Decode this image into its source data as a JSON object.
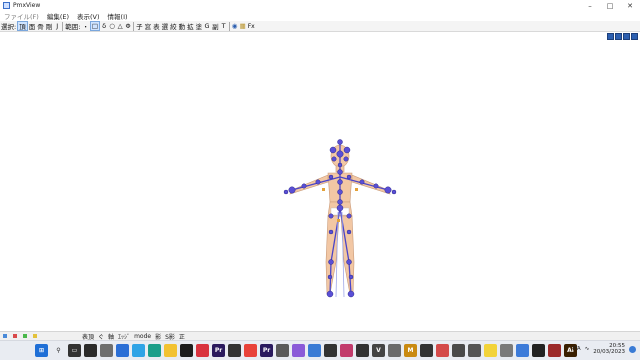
{
  "window": {
    "title": "PmxView"
  },
  "menu": [
    {
      "label": "ファイル(F)",
      "disabled": true
    },
    {
      "label": "編集(E)",
      "disabled": false
    },
    {
      "label": "表示(V)",
      "disabled": false
    },
    {
      "label": "情報(I)",
      "disabled": false
    }
  ],
  "toolbar": {
    "select_label": "選択:",
    "items_a": [
      "頂",
      "面",
      "骨",
      "剛",
      "J"
    ],
    "range_label": "範囲:",
    "items_b": [
      "・",
      "□",
      "δ",
      "○",
      "△",
      "Φ"
    ],
    "items_c": [
      "子",
      "窓",
      "表",
      "選",
      "絞",
      "動",
      "拡",
      "塗",
      "G",
      "副",
      "T"
    ],
    "fx_label": "Fx"
  },
  "statusbar": {
    "labels": [
      "表頂",
      "ぐ",
      "軸",
      "ｴｯｼﾞ",
      "mode",
      "影",
      "S影",
      "正"
    ]
  },
  "taskbar": {
    "apps": [
      {
        "name": "search",
        "glyph": "⚲",
        "color": "#e9ecf2"
      },
      {
        "name": "task-view",
        "glyph": "▭",
        "color": "#333333"
      },
      {
        "name": "app-1",
        "glyph": "",
        "color": "#2b2b2b"
      },
      {
        "name": "app-2",
        "glyph": "",
        "color": "#6e6e6e"
      },
      {
        "name": "app-3",
        "glyph": "",
        "color": "#2b6fd6"
      },
      {
        "name": "app-4",
        "glyph": "",
        "color": "#2fa3e6"
      },
      {
        "name": "edge",
        "glyph": "",
        "color": "#1b9e8a"
      },
      {
        "name": "explorer",
        "glyph": "",
        "color": "#f2c232"
      },
      {
        "name": "app-5",
        "glyph": "",
        "color": "#1d1d1d"
      },
      {
        "name": "app-6",
        "glyph": "",
        "color": "#d9333f"
      },
      {
        "name": "premiere-1",
        "glyph": "Pr",
        "color": "#2a1a5e"
      },
      {
        "name": "app-7",
        "glyph": "",
        "color": "#333333"
      },
      {
        "name": "app-8",
        "glyph": "",
        "color": "#e8423a"
      },
      {
        "name": "premiere-2",
        "glyph": "Pr",
        "color": "#2a1a5e"
      },
      {
        "name": "app-9",
        "glyph": "",
        "color": "#5a5a5a"
      },
      {
        "name": "app-10",
        "glyph": "",
        "color": "#8a5ad8"
      },
      {
        "name": "app-11",
        "glyph": "",
        "color": "#3a7bd5"
      },
      {
        "name": "app-12",
        "glyph": "",
        "color": "#333333"
      },
      {
        "name": "app-13",
        "glyph": "",
        "color": "#c23b6c"
      },
      {
        "name": "app-14",
        "glyph": "",
        "color": "#333333"
      },
      {
        "name": "app-15",
        "glyph": "V",
        "color": "#444444"
      },
      {
        "name": "app-16",
        "glyph": "",
        "color": "#6b6b6b"
      },
      {
        "name": "app-17",
        "glyph": "M",
        "color": "#c98a12"
      },
      {
        "name": "app-18",
        "glyph": "",
        "color": "#333333"
      },
      {
        "name": "app-19",
        "glyph": "",
        "color": "#d44a4a"
      },
      {
        "name": "app-20",
        "glyph": "",
        "color": "#4a4a4a"
      },
      {
        "name": "app-21",
        "glyph": "",
        "color": "#555555"
      },
      {
        "name": "app-22",
        "glyph": "",
        "color": "#f2d33a"
      },
      {
        "name": "app-23",
        "glyph": "",
        "color": "#7a7a7a"
      },
      {
        "name": "app-24",
        "glyph": "",
        "color": "#3d7bd9"
      },
      {
        "name": "app-25",
        "glyph": "",
        "color": "#222222"
      },
      {
        "name": "app-26",
        "glyph": "",
        "color": "#9c2a2a"
      },
      {
        "name": "illustrator",
        "glyph": "Ai",
        "color": "#3a1f00"
      },
      {
        "name": "app-27",
        "glyph": "",
        "color": "#555555"
      },
      {
        "name": "app-28",
        "glyph": "",
        "color": "#c05a2a"
      },
      {
        "name": "photoshop",
        "glyph": "Ps",
        "color": "#0c2340"
      },
      {
        "name": "app-29",
        "glyph": "",
        "color": "#666666"
      }
    ],
    "language": "ITA",
    "time": "20:55",
    "date": "20/03/2023"
  },
  "colors": {
    "bone": "#4b45c8",
    "skin": "#f2c7a4",
    "accent": "#2c5fb0"
  }
}
